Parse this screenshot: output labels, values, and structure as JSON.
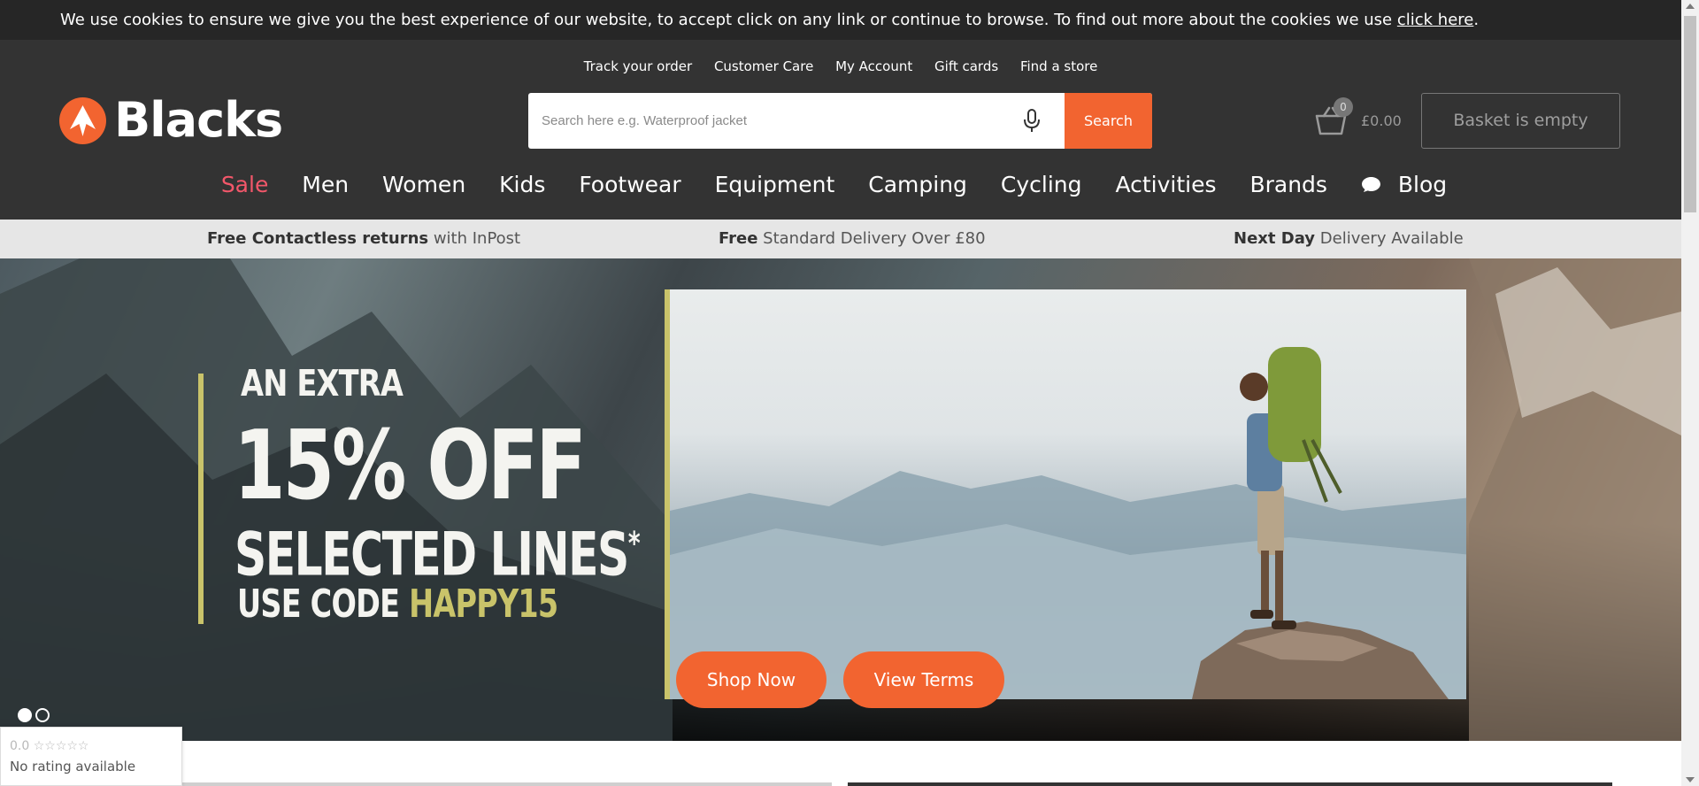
{
  "cookie_banner": {
    "text": "We use cookies to ensure we give you the best experience of our website, to accept click on any link or continue to browse. To find out more about the cookies we use ",
    "link": "click here",
    "end": "."
  },
  "top_links": [
    "Track your order",
    "Customer Care",
    "My Account",
    "Gift cards",
    "Find a store"
  ],
  "logo": {
    "text": "Blacks",
    "icon": "blacks-logo-icon"
  },
  "search": {
    "placeholder": "Search here e.g. Waterproof jacket",
    "button": "Search",
    "mic_icon": "microphone-icon"
  },
  "basket": {
    "count": "0",
    "total": "£0.00",
    "button": "Basket is empty",
    "icon": "basket-icon"
  },
  "nav": {
    "items": [
      "Sale",
      "Men",
      "Women",
      "Kids",
      "Footwear",
      "Equipment",
      "Camping",
      "Cycling",
      "Activities",
      "Brands"
    ],
    "blog": "Blog",
    "blog_icon": "speech-bubble-icon"
  },
  "usp": [
    {
      "bold": "Free Contactless returns",
      "rest": " with InPost"
    },
    {
      "bold": "Free",
      "rest": " Standard Delivery Over £80"
    },
    {
      "bold": "Next Day",
      "rest": " Delivery Available"
    }
  ],
  "hero": {
    "line1": "AN EXTRA",
    "line2": "15% OFF",
    "line3": "SELECTED LINES",
    "asterisk": "*",
    "line4_prefix": "USE CODE ",
    "code": "HAPPY15",
    "cta_primary": "Shop Now",
    "cta_secondary": "View Terms",
    "slide_count": 2,
    "active_slide": 1
  },
  "rating_widget": {
    "score": "0.0",
    "stars": "☆☆☆☆☆",
    "text": "No rating available"
  },
  "colors": {
    "brand_orange": "#f26430",
    "header_bg": "#333333",
    "sale_pink": "#f2576a",
    "promo_accent": "#c9c36a"
  }
}
